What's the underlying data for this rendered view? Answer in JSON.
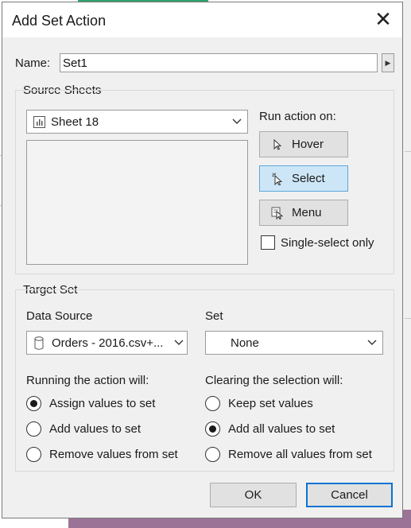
{
  "dialog": {
    "title": "Add Set Action",
    "close_icon": "close-icon"
  },
  "name": {
    "label": "Name:",
    "value": "Set1"
  },
  "source_sheets": {
    "title": "Source Sheets",
    "sheet_selected": "Sheet 18",
    "run_action_label": "Run action on:",
    "actions": [
      {
        "label": "Hover",
        "icon": "pointer-icon",
        "selected": false
      },
      {
        "label": "Select",
        "icon": "select-pointer-icon",
        "selected": true
      },
      {
        "label": "Menu",
        "icon": "menu-pointer-icon",
        "selected": false
      }
    ],
    "single_select_label": "Single-select only"
  },
  "target_set": {
    "title": "Target Set",
    "data_source_label": "Data Source",
    "data_source_value": "Orders - 2016.csv+...",
    "set_label": "Set",
    "set_value": "None",
    "running_label": "Running the action will:",
    "running_options": [
      {
        "label": "Assign values to set",
        "checked": true
      },
      {
        "label": "Add values to set",
        "checked": false
      },
      {
        "label": "Remove values from set",
        "checked": false
      }
    ],
    "clearing_label": "Clearing the selection will:",
    "clearing_options": [
      {
        "label": "Keep set values",
        "checked": false
      },
      {
        "label": "Add all values to set",
        "checked": true
      },
      {
        "label": "Remove all values from set",
        "checked": false
      }
    ]
  },
  "footer": {
    "ok_label": "OK",
    "cancel_label": "Cancel"
  },
  "colors": {
    "selected_button_bg": "#cde6f7",
    "selected_button_border": "#5fa7d9",
    "default_button_focus": "#0a74d1"
  }
}
